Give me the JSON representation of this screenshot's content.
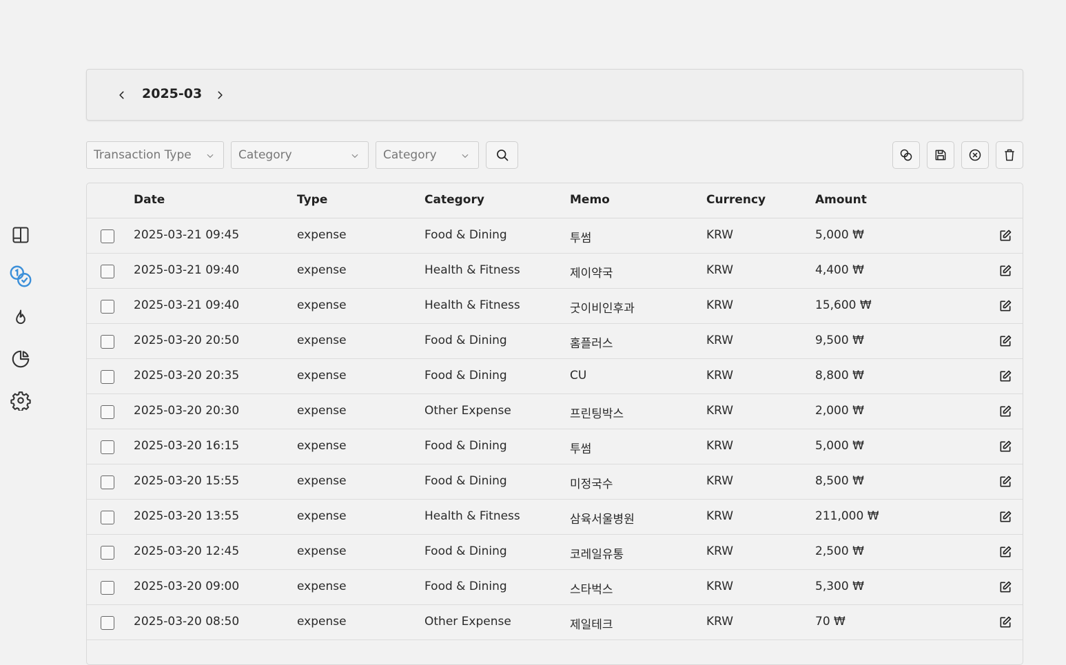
{
  "colors": {
    "accent": "#3b8fd9",
    "icon": "#333333"
  },
  "sidebar": {
    "items": [
      {
        "icon": "book-icon"
      },
      {
        "icon": "coins-icon",
        "active": true
      },
      {
        "icon": "flame-icon"
      },
      {
        "icon": "pie-chart-icon"
      },
      {
        "icon": "gear-icon"
      }
    ]
  },
  "month_nav": {
    "label": "2025-03"
  },
  "filters": {
    "transaction_type": "Transaction Type",
    "category_1": "Category",
    "category_2": "Category"
  },
  "table": {
    "headers": {
      "date": "Date",
      "type": "Type",
      "category": "Category",
      "memo": "Memo",
      "currency": "Currency",
      "amount": "Amount"
    },
    "rows": [
      {
        "date": "2025-03-21 09:45",
        "type": "expense",
        "category": "Food & Dining",
        "memo": "투썸",
        "currency": "KRW",
        "amount": "5,000 ₩"
      },
      {
        "date": "2025-03-21 09:40",
        "type": "expense",
        "category": "Health & Fitness",
        "memo": "제이약국",
        "currency": "KRW",
        "amount": "4,400 ₩"
      },
      {
        "date": "2025-03-21 09:40",
        "type": "expense",
        "category": "Health & Fitness",
        "memo": "굿이비인후과",
        "currency": "KRW",
        "amount": "15,600 ₩"
      },
      {
        "date": "2025-03-20 20:50",
        "type": "expense",
        "category": "Food & Dining",
        "memo": "홈플러스",
        "currency": "KRW",
        "amount": "9,500 ₩"
      },
      {
        "date": "2025-03-20 20:35",
        "type": "expense",
        "category": "Food & Dining",
        "memo": "CU",
        "currency": "KRW",
        "amount": "8,800 ₩"
      },
      {
        "date": "2025-03-20 20:30",
        "type": "expense",
        "category": "Other Expense",
        "memo": "프린팅박스",
        "currency": "KRW",
        "amount": "2,000 ₩"
      },
      {
        "date": "2025-03-20 16:15",
        "type": "expense",
        "category": "Food & Dining",
        "memo": "투썸",
        "currency": "KRW",
        "amount": "5,000 ₩"
      },
      {
        "date": "2025-03-20 15:55",
        "type": "expense",
        "category": "Food & Dining",
        "memo": "미정국수",
        "currency": "KRW",
        "amount": "8,500 ₩"
      },
      {
        "date": "2025-03-20 13:55",
        "type": "expense",
        "category": "Health & Fitness",
        "memo": "삼육서울병원",
        "currency": "KRW",
        "amount": "211,000 ₩"
      },
      {
        "date": "2025-03-20 12:45",
        "type": "expense",
        "category": "Food & Dining",
        "memo": "코레일유통",
        "currency": "KRW",
        "amount": "2,500 ₩"
      },
      {
        "date": "2025-03-20 09:00",
        "type": "expense",
        "category": "Food & Dining",
        "memo": "스타벅스",
        "currency": "KRW",
        "amount": "5,300 ₩"
      },
      {
        "date": "2025-03-20 08:50",
        "type": "expense",
        "category": "Other Expense",
        "memo": "제일테크",
        "currency": "KRW",
        "amount": "70 ₩"
      }
    ]
  }
}
